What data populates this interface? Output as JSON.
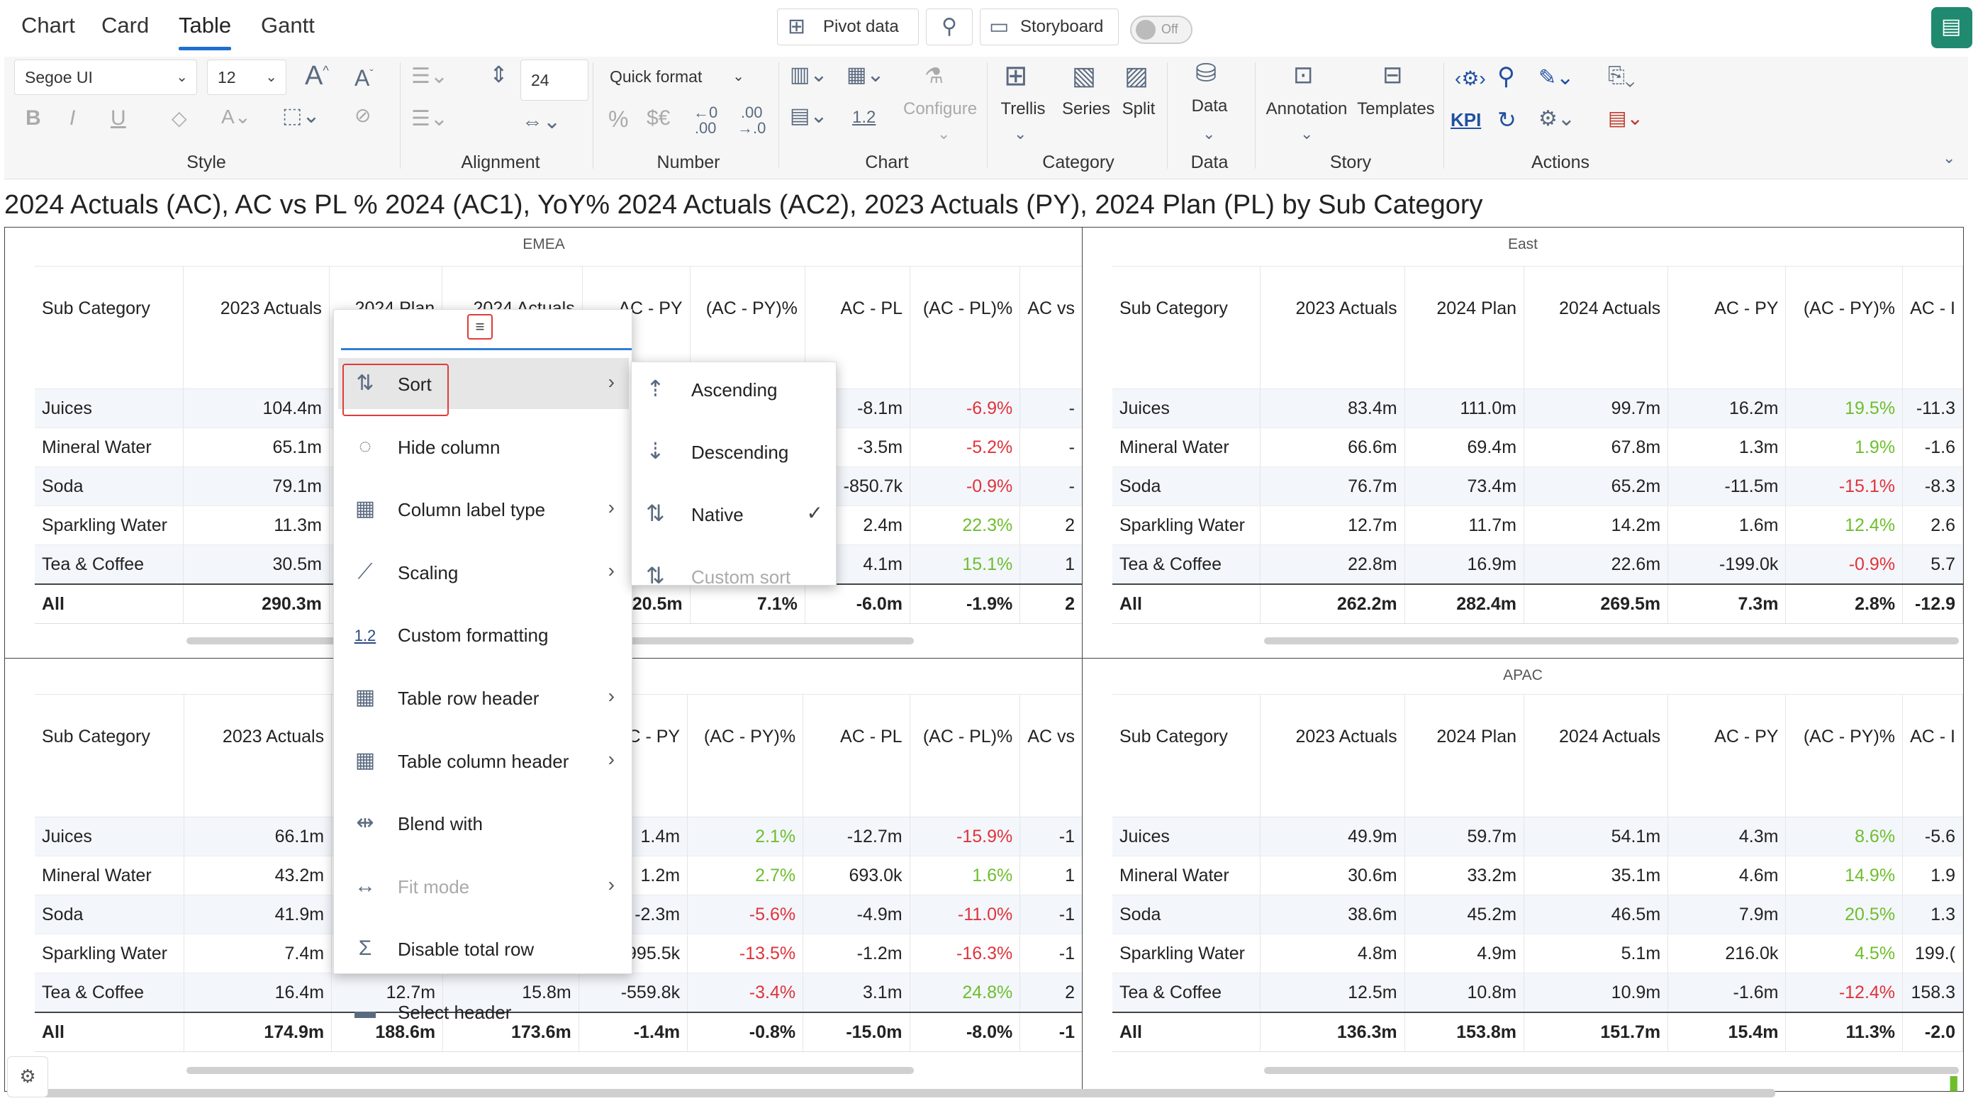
{
  "tabs": [
    "Chart",
    "Card",
    "Table",
    "Gantt"
  ],
  "active_tab": "Table",
  "toolbar": {
    "pivot_data": "Pivot data",
    "storyboard": "Storyboard",
    "toggle": "Off",
    "font_name": "Segoe UI",
    "font_size": "12",
    "row_height": "24",
    "quick_format": "Quick format",
    "decimal_sample": "1.2",
    "configure": "Configure",
    "trellis": "Trellis",
    "series": "Series",
    "split": "Split",
    "data": "Data",
    "annotation": "Annotation",
    "templates": "Templates",
    "kpi": "KPI",
    "groups": {
      "style": "Style",
      "alignment": "Alignment",
      "number": "Number",
      "chart": "Chart",
      "category": "Category",
      "data": "Data",
      "story": "Story",
      "actions": "Actions"
    }
  },
  "title": "2024 Actuals (AC), AC vs PL % 2024 (AC1), YoY% 2024 Actuals (AC2), 2023 Actuals (PY), 2024 Plan (PL) by Sub Category",
  "panels": {
    "emea": {
      "title": "EMEA",
      "headers": [
        "Sub Category",
        "2023 Actuals",
        "2024 Plan",
        "2024 Actuals",
        "AC - PY",
        "(AC - PY)%",
        "AC - PL",
        "(AC - PL)%",
        "AC vs"
      ],
      "rows": [
        [
          "Juices",
          "104.4m",
          "",
          "",
          "",
          "",
          "-8.1m",
          "-6.9%",
          "-"
        ],
        [
          "Mineral Water",
          "65.1m",
          "",
          "",
          "",
          "",
          "-3.5m",
          "-5.2%",
          "-"
        ],
        [
          "Soda",
          "79.1m",
          "",
          "",
          "",
          "",
          "-850.7k",
          "-0.9%",
          "-"
        ],
        [
          "Sparkling Water",
          "11.3m",
          "",
          "",
          "",
          "",
          "2.4m",
          "22.3%",
          "2"
        ],
        [
          "Tea & Coffee",
          "30.5m",
          "",
          "",
          "",
          "",
          "4.1m",
          "15.1%",
          "1"
        ]
      ],
      "total": [
        "All",
        "290.3m",
        "",
        "",
        "20.5m",
        "7.1%",
        "-6.0m",
        "-1.9%",
        "2"
      ]
    },
    "east": {
      "title": "East",
      "headers": [
        "Sub Category",
        "2023 Actuals",
        "2024 Plan",
        "2024 Actuals",
        "AC - PY",
        "(AC - PY)%",
        "AC - I"
      ],
      "rows": [
        [
          "Juices",
          "83.4m",
          "111.0m",
          "99.7m",
          "16.2m",
          "19.5%",
          "-11.3"
        ],
        [
          "Mineral Water",
          "66.6m",
          "69.4m",
          "67.8m",
          "1.3m",
          "1.9%",
          "-1.6"
        ],
        [
          "Soda",
          "76.7m",
          "73.4m",
          "65.2m",
          "-11.5m",
          "-15.1%",
          "-8.3"
        ],
        [
          "Sparkling Water",
          "12.7m",
          "11.7m",
          "14.2m",
          "1.6m",
          "12.4%",
          "2.6"
        ],
        [
          "Tea & Coffee",
          "22.8m",
          "16.9m",
          "22.6m",
          "-199.0k",
          "-0.9%",
          "5.7"
        ]
      ],
      "total": [
        "All",
        "262.2m",
        "282.4m",
        "269.5m",
        "7.3m",
        "2.8%",
        "-12.9"
      ]
    },
    "west": {
      "title": "",
      "headers": [
        "Sub Category",
        "2023 Actuals",
        "",
        "",
        "C - PY",
        "(AC - PY)%",
        "AC - PL",
        "(AC - PL)%",
        "AC vs"
      ],
      "rows": [
        [
          "Juices",
          "66.1m",
          "",
          "",
          "1.4m",
          "2.1%",
          "-12.7m",
          "-15.9%",
          "-1"
        ],
        [
          "Mineral Water",
          "43.2m",
          "",
          "",
          "1.2m",
          "2.7%",
          "693.0k",
          "1.6%",
          "1"
        ],
        [
          "Soda",
          "41.9m",
          "",
          "",
          "-2.3m",
          "-5.6%",
          "-4.9m",
          "-11.0%",
          "-1"
        ],
        [
          "Sparkling Water",
          "7.4m",
          "",
          "",
          "995.5k",
          "-13.5%",
          "-1.2m",
          "-16.3%",
          "-1"
        ],
        [
          "Tea & Coffee",
          "16.4m",
          "12.7m",
          "15.8m",
          "-559.8k",
          "-3.4%",
          "3.1m",
          "24.8%",
          "2"
        ]
      ],
      "total": [
        "All",
        "174.9m",
        "188.6m",
        "173.6m",
        "-1.4m",
        "-0.8%",
        "-15.0m",
        "-8.0%",
        "-1"
      ]
    },
    "apac": {
      "title": "APAC",
      "headers": [
        "Sub Category",
        "2023 Actuals",
        "2024 Plan",
        "2024 Actuals",
        "AC - PY",
        "(AC - PY)%",
        "AC - I"
      ],
      "rows": [
        [
          "Juices",
          "49.9m",
          "59.7m",
          "54.1m",
          "4.3m",
          "8.6%",
          "-5.6"
        ],
        [
          "Mineral Water",
          "30.6m",
          "33.2m",
          "35.1m",
          "4.6m",
          "14.9%",
          "1.9"
        ],
        [
          "Soda",
          "38.6m",
          "45.2m",
          "46.5m",
          "7.9m",
          "20.5%",
          "1.3"
        ],
        [
          "Sparkling Water",
          "4.8m",
          "4.9m",
          "5.1m",
          "216.0k",
          "4.5%",
          "199.("
        ],
        [
          "Tea & Coffee",
          "12.5m",
          "10.8m",
          "10.9m",
          "-1.6m",
          "-12.4%",
          "158.3"
        ]
      ],
      "total": [
        "All",
        "136.3m",
        "153.8m",
        "151.7m",
        "15.4m",
        "11.3%",
        "-2.0"
      ]
    }
  },
  "context_menu": {
    "items": [
      {
        "label": "Sort",
        "icon": "sort-icon",
        "arrow": true,
        "disabled": false
      },
      {
        "label": "Hide column",
        "icon": "hide-icon",
        "arrow": false,
        "disabled": false
      },
      {
        "label": "Column label type",
        "icon": "label-type-icon",
        "arrow": true,
        "disabled": false
      },
      {
        "label": "Scaling",
        "icon": "ruler-icon",
        "arrow": true,
        "disabled": false
      },
      {
        "label": "Custom formatting",
        "icon": "format-icon",
        "arrow": false,
        "disabled": false
      },
      {
        "label": "Table row header",
        "icon": "row-header-icon",
        "arrow": true,
        "disabled": false
      },
      {
        "label": "Table column header",
        "icon": "column-header-icon",
        "arrow": true,
        "disabled": false
      },
      {
        "label": "Blend with",
        "icon": "blend-icon",
        "arrow": false,
        "disabled": false
      },
      {
        "label": "Fit mode",
        "icon": "fit-icon",
        "arrow": true,
        "disabled": true
      },
      {
        "label": "Disable total row",
        "icon": "total-row-icon",
        "arrow": false,
        "disabled": false
      },
      {
        "label": "Select header",
        "icon": "select-header-icon",
        "arrow": false,
        "disabled": false
      }
    ],
    "custom_formatting_icon_text": "1.2"
  },
  "sort_submenu": {
    "items": [
      {
        "label": "Ascending",
        "checked": false,
        "disabled": false
      },
      {
        "label": "Descending",
        "checked": false,
        "disabled": false
      },
      {
        "label": "Native",
        "checked": true,
        "disabled": false
      },
      {
        "label": "Custom sort",
        "checked": false,
        "disabled": true
      }
    ]
  },
  "colors": {
    "accent": "#1f6fd1",
    "negative": "#e0333a",
    "positive": "#6ebe2c",
    "highlight": "#e03a3a"
  }
}
